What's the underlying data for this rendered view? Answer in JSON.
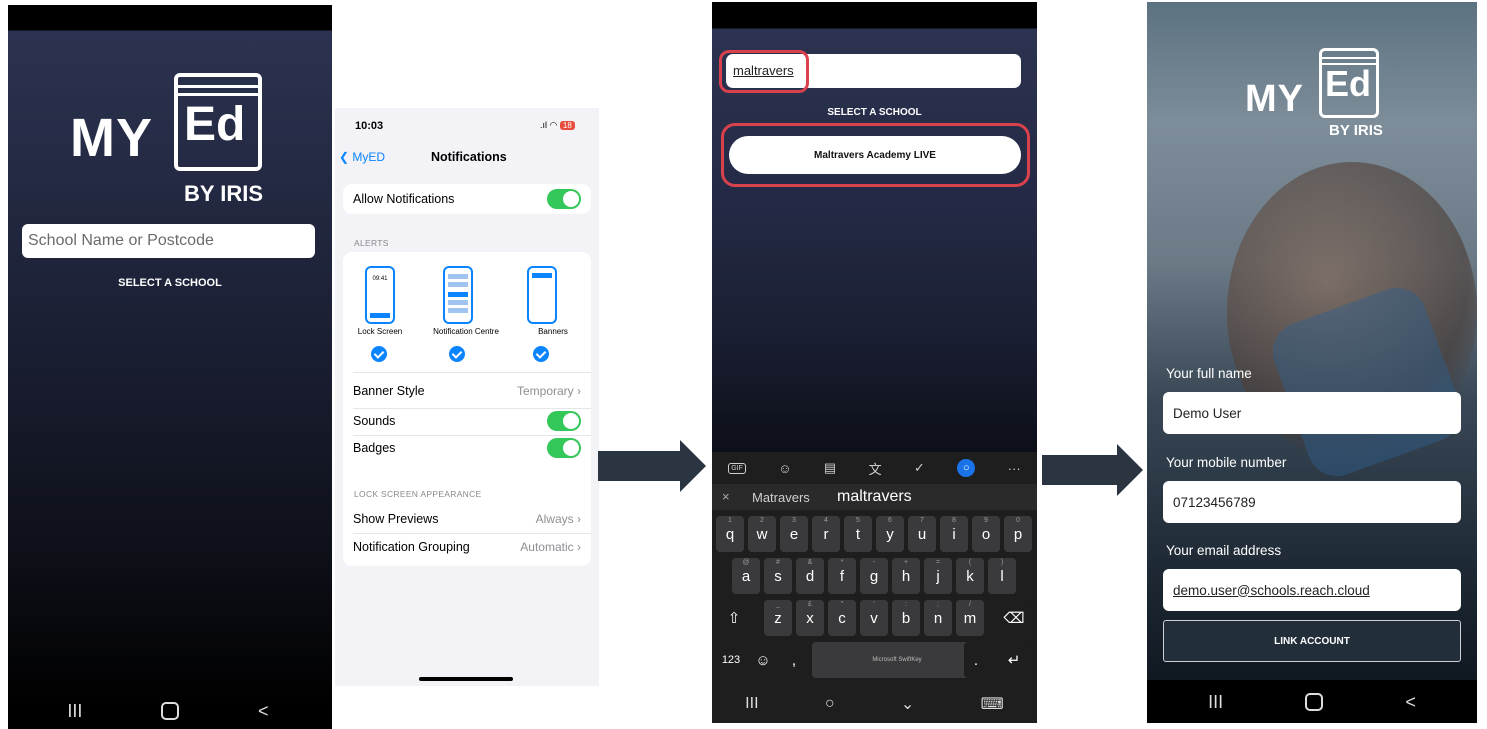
{
  "phone1": {
    "logo": {
      "my": "MY",
      "ed": "Ed",
      "by": "BY IRIS"
    },
    "search_placeholder": "School Name or Postcode",
    "select_label": "SELECT A SCHOOL"
  },
  "phone2": {
    "status_time": "10:03",
    "battery": "18",
    "back_label": "MyED",
    "title": "Notifications",
    "allow_notifications": "Allow Notifications",
    "alerts_header": "ALERTS",
    "alert_styles": [
      {
        "label": "Lock Screen",
        "preview_time": "09:41"
      },
      {
        "label": "Notification Centre"
      },
      {
        "label": "Banners"
      }
    ],
    "banner_style_label": "Banner Style",
    "banner_style_value": "Temporary",
    "sounds_label": "Sounds",
    "badges_label": "Badges",
    "lockscreen_header": "LOCK SCREEN APPEARANCE",
    "show_previews_label": "Show Previews",
    "show_previews_value": "Always",
    "grouping_label": "Notification Grouping",
    "grouping_value": "Automatic"
  },
  "phone3": {
    "search_value": "maltravers",
    "select_label": "SELECT A SCHOOL",
    "result_label": "Maltravers Academy LIVE",
    "suggestions": [
      "Matravers",
      "maltravers"
    ],
    "toolbar_icons": [
      "gif-icon",
      "sticker-icon",
      "clipboard-icon",
      "translate-icon",
      "pen-icon",
      "bulb-icon",
      "more-icon"
    ],
    "gif_label": "GIF",
    "more_label": "···",
    "rows": [
      [
        {
          "k": "q",
          "h": "1"
        },
        {
          "k": "w",
          "h": "2"
        },
        {
          "k": "e",
          "h": "3"
        },
        {
          "k": "r",
          "h": "4"
        },
        {
          "k": "t",
          "h": "5"
        },
        {
          "k": "y",
          "h": "6"
        },
        {
          "k": "u",
          "h": "7"
        },
        {
          "k": "i",
          "h": "8"
        },
        {
          "k": "o",
          "h": "9"
        },
        {
          "k": "p",
          "h": "0"
        }
      ],
      [
        {
          "k": "a",
          "h": "@"
        },
        {
          "k": "s",
          "h": "#"
        },
        {
          "k": "d",
          "h": "&"
        },
        {
          "k": "f",
          "h": "*"
        },
        {
          "k": "g",
          "h": "-"
        },
        {
          "k": "h",
          "h": "+"
        },
        {
          "k": "j",
          "h": "="
        },
        {
          "k": "k",
          "h": "("
        },
        {
          "k": "l",
          "h": ")"
        }
      ],
      [
        {
          "k": "z",
          "h": "_"
        },
        {
          "k": "x",
          "h": "£"
        },
        {
          "k": "c",
          "h": "\""
        },
        {
          "k": "v",
          "h": "'"
        },
        {
          "k": "b",
          "h": ":"
        },
        {
          "k": "n",
          "h": ";"
        },
        {
          "k": "m",
          "h": "/"
        }
      ]
    ],
    "num_key": "123",
    "comma_key": ",",
    "period_key": ".",
    "space_label": "Microsoft SwiftKey"
  },
  "phone4": {
    "logo": {
      "my": "MY",
      "ed": "Ed",
      "by": "BY IRIS"
    },
    "name_label": "Your full name",
    "name_value": "Demo User",
    "mobile_label": "Your mobile number",
    "mobile_value": "07123456789",
    "email_label": "Your email address",
    "email_value": "demo.user@schools.reach.cloud",
    "link_button": "LINK ACCOUNT"
  },
  "nav": {
    "recent": "III",
    "home": "O",
    "back": "<"
  }
}
